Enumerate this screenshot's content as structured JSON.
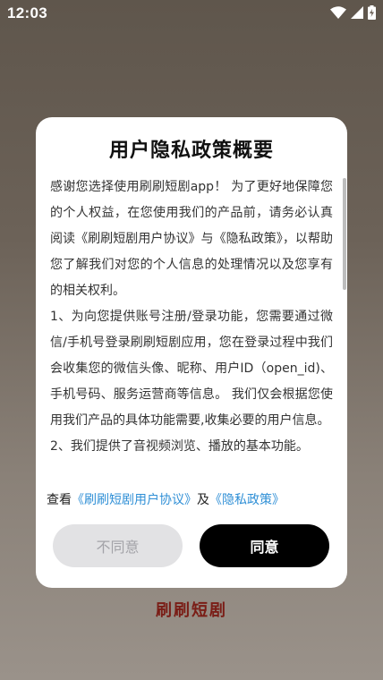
{
  "status_bar": {
    "time": "12:03"
  },
  "background": {
    "brand_text": "刷刷短剧"
  },
  "dialog": {
    "title": "用户隐私政策概要",
    "paragraphs": [
      "感谢您选择使用刷刷短剧app！ 为了更好地保障您的个人权益，在您使用我们的产品前，请务必认真阅读《刷刷短剧用户协议》与《隐私政策》，以帮助您了解我们对您的个人信息的处理情况以及您享有的相关权利。",
      "1、为向您提供账号注册/登录功能，您需要通过微信/手机号登录刷刷短剧应用，您在登录过程中我们会收集您的微信头像、昵称、用户ID（open_id)、手机号码、服务运营商等信息。 我们仅会根据您使用我们产品的具体功能需要,收集必要的用户信息。",
      "2、我们提供了音视频浏览、播放的基本功能。"
    ],
    "agree_prefix": "查看",
    "user_agreement_link": "《刷刷短剧用户协议》",
    "conjunction": "及",
    "privacy_policy_link": "《隐私政策》",
    "disagree_label": "不同意",
    "agree_label": "同意"
  }
}
